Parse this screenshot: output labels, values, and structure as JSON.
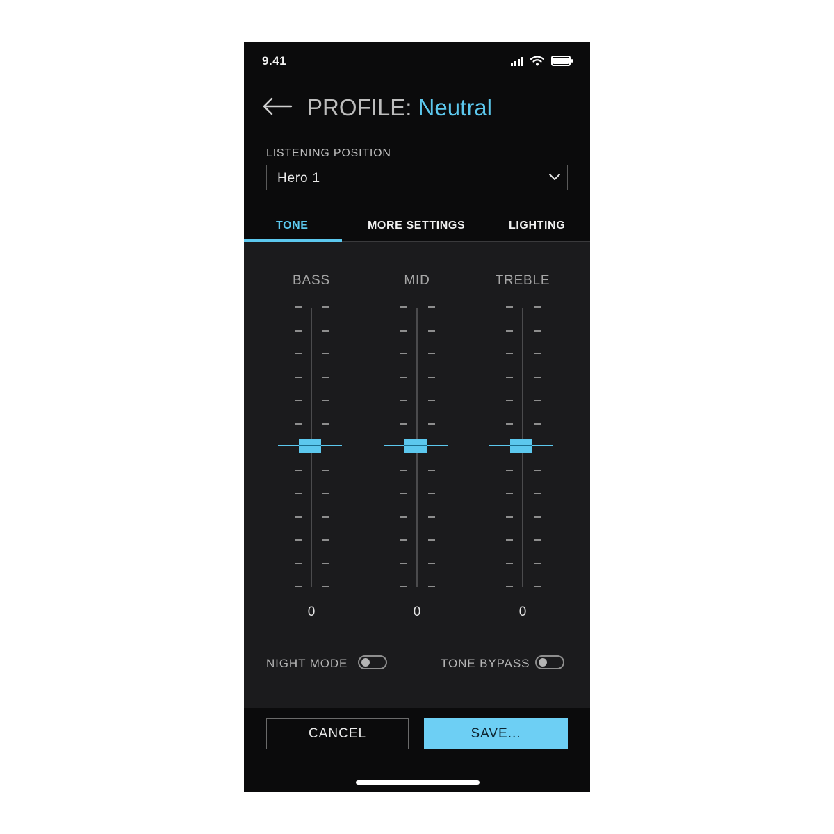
{
  "status_bar": {
    "time": "9.41",
    "icons": [
      "cellular-signal-icon",
      "wifi-icon",
      "battery-icon"
    ]
  },
  "header": {
    "back_icon": "arrow-left-icon",
    "profile_prefix": "PROFILE: ",
    "profile_name": "Neutral"
  },
  "listening_position": {
    "label": "LISTENING POSITION",
    "selected": "Hero 1",
    "dropdown_icon": "chevron-down-icon"
  },
  "tabs": [
    {
      "label": "TONE",
      "active": true
    },
    {
      "label": "MORE SETTINGS",
      "active": false
    },
    {
      "label": "LIGHTING",
      "active": false
    }
  ],
  "eq": {
    "bands": [
      {
        "label": "BASS",
        "value": "0"
      },
      {
        "label": "MID",
        "value": "0"
      },
      {
        "label": "TREBLE",
        "value": "0"
      }
    ]
  },
  "toggles": {
    "night_mode": {
      "label": "NIGHT MODE",
      "on": false
    },
    "tone_bypass": {
      "label": "TONE BYPASS",
      "on": false
    }
  },
  "actions": {
    "cancel_label": "CANCEL",
    "save_label": "SAVE..."
  },
  "colors": {
    "accent": "#5cc8ee",
    "save_button": "#6dcff4",
    "background": "#0b0b0c",
    "panel": "#1b1b1d"
  }
}
